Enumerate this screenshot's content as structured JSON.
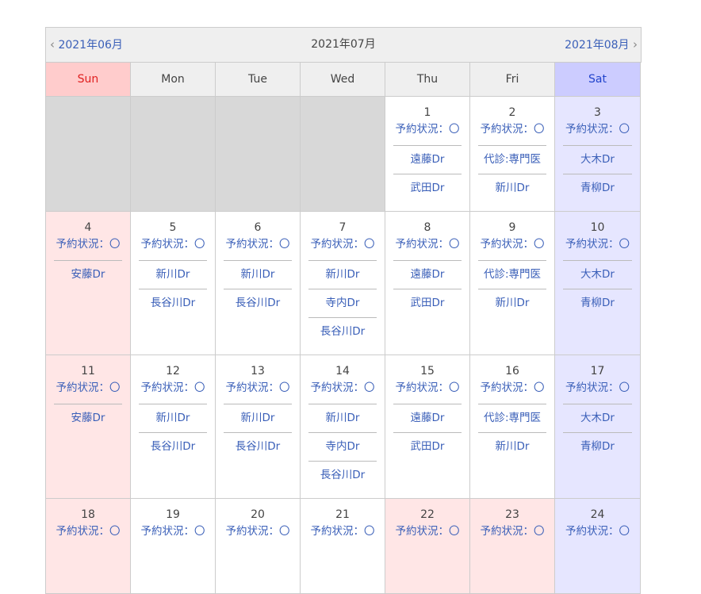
{
  "nav": {
    "prev_label": "2021年06月",
    "current_label": "2021年07月",
    "next_label": "2021年08月"
  },
  "weekdays": [
    "Sun",
    "Mon",
    "Tue",
    "Wed",
    "Thu",
    "Fri",
    "Sat"
  ],
  "weeks": [
    [
      {
        "empty": true
      },
      {
        "empty": true
      },
      {
        "empty": true
      },
      {
        "empty": true
      },
      {
        "day": "1",
        "status": "予約状況：〇",
        "doctors": [
          "遠藤Dr",
          "武田Dr"
        ]
      },
      {
        "day": "2",
        "status": "予約状況：〇",
        "doctors": [
          "代診:専門医",
          "新川Dr"
        ]
      },
      {
        "day": "3",
        "status": "予約状況：〇",
        "doctors": [
          "大木Dr",
          "青柳Dr"
        ]
      }
    ],
    [
      {
        "day": "4",
        "status": "予約状況：〇",
        "doctors": [
          "安藤Dr"
        ]
      },
      {
        "day": "5",
        "status": "予約状況：〇",
        "doctors": [
          "新川Dr",
          "長谷川Dr"
        ]
      },
      {
        "day": "6",
        "status": "予約状況：〇",
        "doctors": [
          "新川Dr",
          "長谷川Dr"
        ]
      },
      {
        "day": "7",
        "status": "予約状況：〇",
        "doctors": [
          "新川Dr",
          "寺内Dr",
          "長谷川Dr"
        ]
      },
      {
        "day": "8",
        "status": "予約状況：〇",
        "doctors": [
          "遠藤Dr",
          "武田Dr"
        ]
      },
      {
        "day": "9",
        "status": "予約状況：〇",
        "doctors": [
          "代診:専門医",
          "新川Dr"
        ]
      },
      {
        "day": "10",
        "status": "予約状況：〇",
        "doctors": [
          "大木Dr",
          "青柳Dr"
        ]
      }
    ],
    [
      {
        "day": "11",
        "status": "予約状況：〇",
        "doctors": [
          "安藤Dr"
        ]
      },
      {
        "day": "12",
        "status": "予約状況：〇",
        "doctors": [
          "新川Dr",
          "長谷川Dr"
        ]
      },
      {
        "day": "13",
        "status": "予約状況：〇",
        "doctors": [
          "新川Dr",
          "長谷川Dr"
        ]
      },
      {
        "day": "14",
        "status": "予約状況：〇",
        "doctors": [
          "新川Dr",
          "寺内Dr",
          "長谷川Dr"
        ]
      },
      {
        "day": "15",
        "status": "予約状況：〇",
        "doctors": [
          "遠藤Dr",
          "武田Dr"
        ]
      },
      {
        "day": "16",
        "status": "予約状況：〇",
        "doctors": [
          "代診:専門医",
          "新川Dr"
        ]
      },
      {
        "day": "17",
        "status": "予約状況：〇",
        "doctors": [
          "大木Dr",
          "青柳Dr"
        ]
      }
    ],
    [
      {
        "day": "18",
        "status": "予約状況：〇",
        "doctors": []
      },
      {
        "day": "19",
        "status": "予約状況：〇",
        "doctors": []
      },
      {
        "day": "20",
        "status": "予約状況：〇",
        "doctors": []
      },
      {
        "day": "21",
        "status": "予約状況：〇",
        "doctors": []
      },
      {
        "day": "22",
        "status": "予約状況：〇",
        "doctors": [],
        "holiday": true
      },
      {
        "day": "23",
        "status": "予約状況：〇",
        "doctors": [],
        "holiday": true
      },
      {
        "day": "24",
        "status": "予約状況：〇",
        "doctors": []
      }
    ]
  ]
}
